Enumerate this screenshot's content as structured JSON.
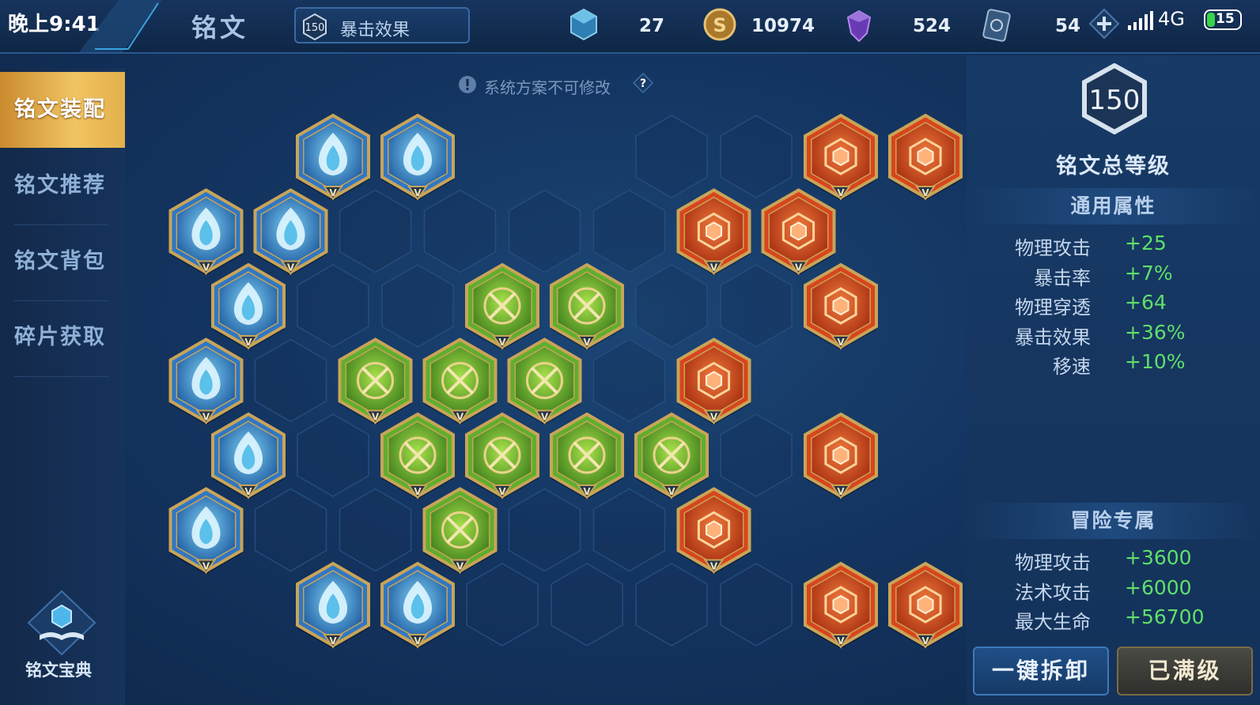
{
  "status_bar": {
    "time": "晚上9:41",
    "network": "4G",
    "battery": "15"
  },
  "header": {
    "title": "铭文",
    "preset": {
      "level": "150",
      "name": "暴击效果"
    },
    "currencies": [
      {
        "icon": "crystal-icon",
        "value": "27"
      },
      {
        "icon": "gold-coin-icon",
        "value": "10974"
      },
      {
        "icon": "purple-gem-icon",
        "value": "524"
      },
      {
        "icon": "fragment-card-icon",
        "value": "54"
      }
    ]
  },
  "sidebar": {
    "items": [
      {
        "label": "铭文装配",
        "active": true
      },
      {
        "label": "铭文推荐",
        "active": false
      },
      {
        "label": "铭文背包",
        "active": false
      },
      {
        "label": "碎片获取",
        "active": false
      }
    ],
    "codex_label": "铭文宝典"
  },
  "notice": {
    "text": "系统方案不可修改",
    "help": "?"
  },
  "board": {
    "slots": [
      {
        "c": 2,
        "r": 0,
        "color": "blue"
      },
      {
        "c": 3,
        "r": 0,
        "color": "blue"
      },
      {
        "c": 6,
        "r": 0,
        "color": "empty"
      },
      {
        "c": 7,
        "r": 0,
        "color": "empty"
      },
      {
        "c": 8,
        "r": 0,
        "color": "red"
      },
      {
        "c": 9,
        "r": 0,
        "color": "red"
      },
      {
        "c": 1,
        "r": 1,
        "color": "blue"
      },
      {
        "c": 2,
        "r": 1,
        "color": "blue"
      },
      {
        "c": 3,
        "r": 1,
        "color": "empty"
      },
      {
        "c": 4,
        "r": 1,
        "color": "empty"
      },
      {
        "c": 5,
        "r": 1,
        "color": "empty"
      },
      {
        "c": 6,
        "r": 1,
        "color": "empty"
      },
      {
        "c": 7,
        "r": 1,
        "color": "red"
      },
      {
        "c": 8,
        "r": 1,
        "color": "red"
      },
      {
        "c": 1,
        "r": 2,
        "color": "blue"
      },
      {
        "c": 2,
        "r": 2,
        "color": "empty"
      },
      {
        "c": 3,
        "r": 2,
        "color": "empty"
      },
      {
        "c": 4,
        "r": 2,
        "color": "green"
      },
      {
        "c": 5,
        "r": 2,
        "color": "green"
      },
      {
        "c": 6,
        "r": 2,
        "color": "empty"
      },
      {
        "c": 7,
        "r": 2,
        "color": "empty"
      },
      {
        "c": 8,
        "r": 2,
        "color": "red"
      },
      {
        "c": 1,
        "r": 3,
        "color": "blue"
      },
      {
        "c": 2,
        "r": 3,
        "color": "empty"
      },
      {
        "c": 3,
        "r": 3,
        "color": "green"
      },
      {
        "c": 4,
        "r": 3,
        "color": "green"
      },
      {
        "c": 5,
        "r": 3,
        "color": "green"
      },
      {
        "c": 6,
        "r": 3,
        "color": "empty"
      },
      {
        "c": 7,
        "r": 3,
        "color": "red"
      },
      {
        "c": 1,
        "r": 4,
        "color": "blue"
      },
      {
        "c": 2,
        "r": 4,
        "color": "empty"
      },
      {
        "c": 3,
        "r": 4,
        "color": "green"
      },
      {
        "c": 4,
        "r": 4,
        "color": "green"
      },
      {
        "c": 5,
        "r": 4,
        "color": "green"
      },
      {
        "c": 6,
        "r": 4,
        "color": "green"
      },
      {
        "c": 7,
        "r": 4,
        "color": "empty"
      },
      {
        "c": 8,
        "r": 4,
        "color": "red"
      },
      {
        "c": 1,
        "r": 5,
        "color": "blue"
      },
      {
        "c": 2,
        "r": 5,
        "color": "empty"
      },
      {
        "c": 3,
        "r": 5,
        "color": "empty"
      },
      {
        "c": 4,
        "r": 5,
        "color": "green"
      },
      {
        "c": 5,
        "r": 5,
        "color": "empty"
      },
      {
        "c": 6,
        "r": 5,
        "color": "empty"
      },
      {
        "c": 7,
        "r": 5,
        "color": "red"
      },
      {
        "c": 2,
        "r": 6,
        "color": "blue"
      },
      {
        "c": 3,
        "r": 6,
        "color": "blue"
      },
      {
        "c": 4,
        "r": 6,
        "color": "empty"
      },
      {
        "c": 5,
        "r": 6,
        "color": "empty"
      },
      {
        "c": 6,
        "r": 6,
        "color": "empty"
      },
      {
        "c": 7,
        "r": 6,
        "color": "empty"
      },
      {
        "c": 8,
        "r": 6,
        "color": "red"
      },
      {
        "c": 9,
        "r": 6,
        "color": "red"
      }
    ],
    "grade_mark": "V",
    "colors": {
      "blue": "#2f77c4",
      "red": "#d8451d",
      "green": "#5fae2d",
      "frame": "#c9a458"
    }
  },
  "right_panel": {
    "total_level": "150",
    "total_level_label": "铭文总等级",
    "general": {
      "title": "通用属性",
      "stats": [
        {
          "name": "物理攻击",
          "value": "+25"
        },
        {
          "name": "暴击率",
          "value": "+7%"
        },
        {
          "name": "物理穿透",
          "value": "+64"
        },
        {
          "name": "暴击效果",
          "value": "+36%"
        },
        {
          "name": "移速",
          "value": "+10%"
        }
      ]
    },
    "adventure": {
      "title": "冒险专属",
      "stats": [
        {
          "name": "物理攻击",
          "value": "+3600"
        },
        {
          "name": "法术攻击",
          "value": "+6000"
        },
        {
          "name": "最大生命",
          "value": "+56700"
        }
      ]
    },
    "buttons": {
      "dismount": "一键拆卸",
      "maxed": "已满级"
    }
  }
}
